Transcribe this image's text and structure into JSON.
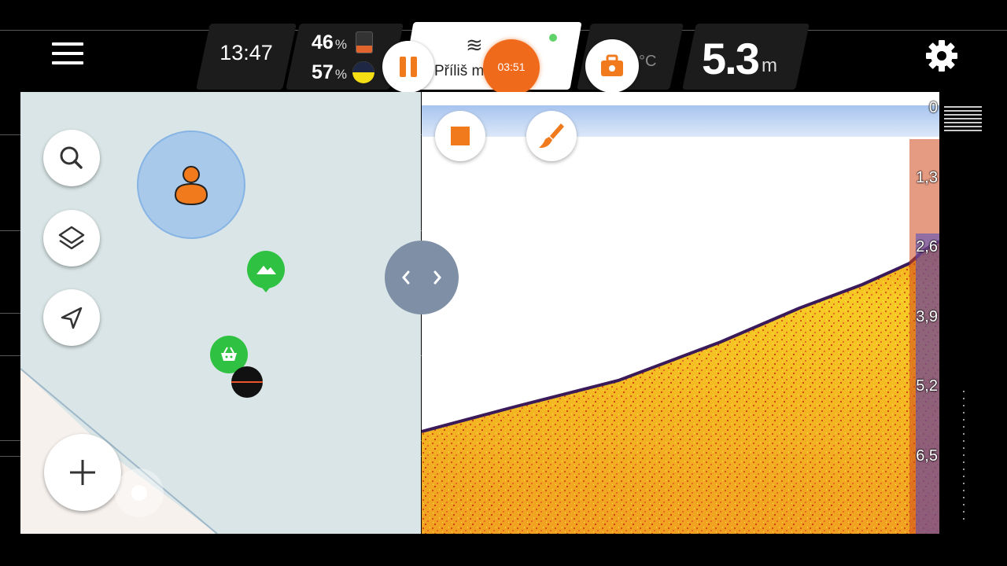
{
  "topbar": {
    "time": "13:47",
    "battery_phone": {
      "value": "46",
      "unit": "%"
    },
    "battery_sonar": {
      "value": "57",
      "unit": "%"
    },
    "status_text": "Příliš m",
    "recording_time": "03:51",
    "temperature_unit": "°C",
    "depth": {
      "value": "5.3",
      "unit": "m"
    }
  },
  "map": {
    "buttons": [
      "search-icon",
      "layers-icon",
      "navigation-icon",
      "plus-icon"
    ],
    "markers": [
      "mountain-pin",
      "basket-pin"
    ]
  },
  "sonar": {
    "depth_scale": [
      "0",
      "1,3",
      "2,6",
      "3,9",
      "5,2",
      "6,5"
    ]
  },
  "colors": {
    "accent": "#f06a1c",
    "sonar_bottom": "#f5c623",
    "sonar_strong": "#d73a17",
    "map_water": "#d9e5e6",
    "pin_green": "#2fc242"
  }
}
